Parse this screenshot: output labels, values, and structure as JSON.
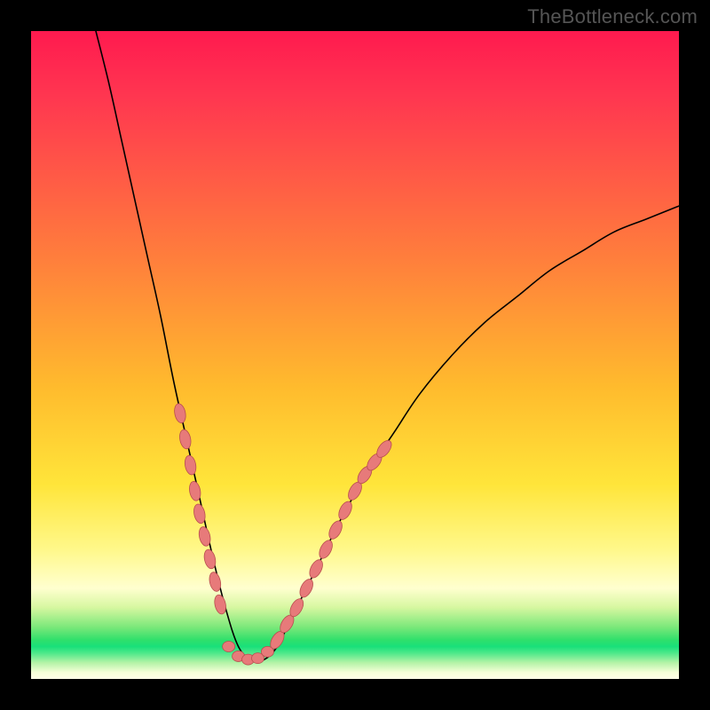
{
  "watermark": "TheBottleneck.com",
  "colors": {
    "frame": "#000000",
    "gradient_top": "#ff1a4f",
    "gradient_mid_orange": "#ffbb2d",
    "gradient_yellow": "#ffe53a",
    "gradient_pale": "#ffffcf",
    "gradient_green": "#19e07a",
    "curve": "#000000",
    "bead_fill": "#e77a7a",
    "bead_stroke": "#b84e4e"
  },
  "chart_data": {
    "type": "line",
    "title": "",
    "xlabel": "",
    "ylabel": "",
    "xlim": [
      0,
      100
    ],
    "ylim": [
      0,
      100
    ],
    "grid": false,
    "legend": false,
    "annotations": [],
    "description": "A single V-shaped curve on a vertical rainbow gradient. Left branch descends steeply from top-left toward a rounded trough near x≈33, bottoming out near y≈3, then the right branch rises more gently and convexly toward the upper-right, ending near y≈73 at x=100. Segments of the curve near the trough are overlaid with oblong pink beads on both branches.",
    "series": [
      {
        "name": "curve",
        "x": [
          10,
          12,
          14,
          16,
          18,
          20,
          22,
          24,
          26,
          28,
          30,
          32,
          34,
          36,
          38,
          40,
          44,
          48,
          52,
          56,
          60,
          65,
          70,
          75,
          80,
          85,
          90,
          95,
          100
        ],
        "y": [
          100,
          92,
          83,
          74,
          65,
          56,
          46,
          37,
          28,
          19,
          11,
          5,
          3,
          3,
          5,
          9,
          17,
          25,
          32,
          38,
          44,
          50,
          55,
          59,
          63,
          66,
          69,
          71,
          73
        ]
      }
    ],
    "beads_left": {
      "note": "pink oblong markers along left branch, approximate y positions",
      "x": [
        23.0,
        23.8,
        24.6,
        25.3,
        26.0,
        26.8,
        27.6,
        28.4,
        29.2
      ],
      "y": [
        41.0,
        37.0,
        33.0,
        29.0,
        25.5,
        22.0,
        18.5,
        15.0,
        11.5
      ]
    },
    "beads_right": {
      "note": "pink oblong markers along right branch, approximate y positions",
      "x": [
        38.0,
        39.5,
        41.0,
        42.5,
        44.0,
        45.5,
        47.0,
        48.5,
        50.0,
        51.5,
        53.0,
        54.5
      ],
      "y": [
        6.0,
        8.5,
        11.0,
        14.0,
        17.0,
        20.0,
        23.0,
        26.0,
        29.0,
        31.5,
        33.5,
        35.5
      ]
    },
    "beads_bottom": {
      "note": "pink round markers along flat trough",
      "x": [
        30.5,
        32.0,
        33.5,
        35.0,
        36.5
      ],
      "y": [
        5.0,
        3.5,
        3.0,
        3.2,
        4.2
      ]
    }
  }
}
